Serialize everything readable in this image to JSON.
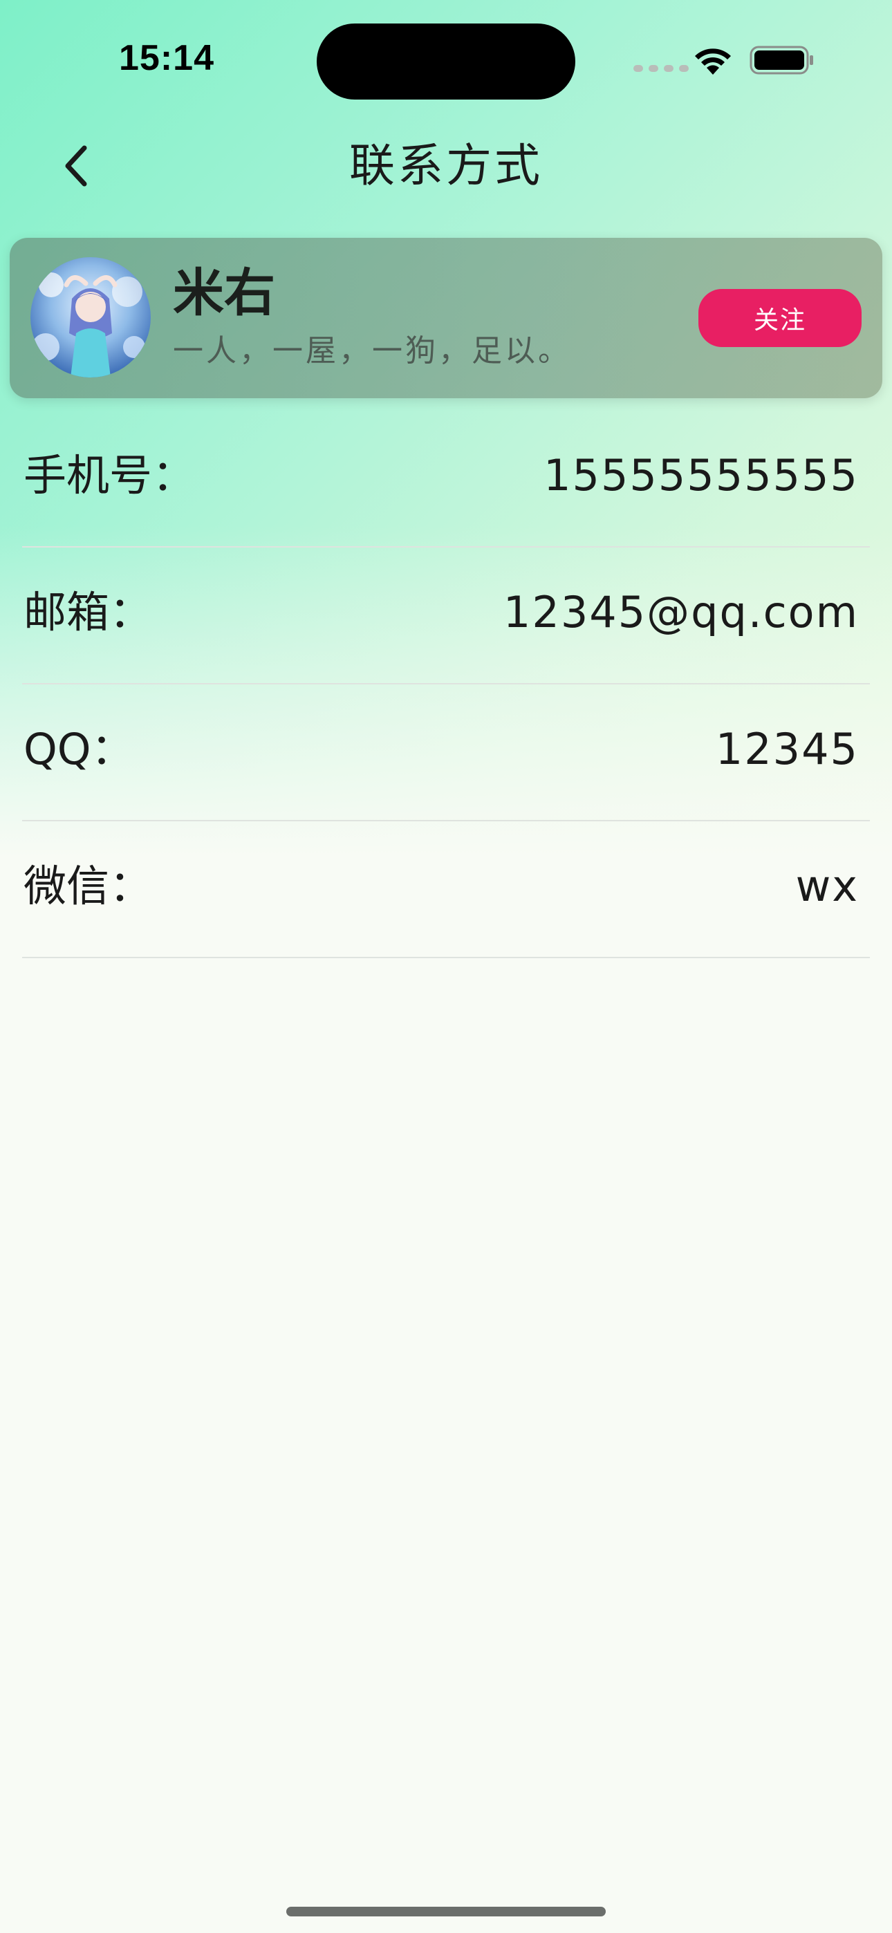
{
  "status_bar": {
    "time": "15:14"
  },
  "nav": {
    "title": "联系方式",
    "back_icon": "chevron-left-icon"
  },
  "profile": {
    "name": "米右",
    "bio": "一人，一屋，一狗，足以。",
    "follow_label": "关注",
    "follow_color": "#e81f63"
  },
  "contacts": [
    {
      "label": "手机号：",
      "value": "15555555555"
    },
    {
      "label": "邮箱：",
      "value": "12345@qq.com"
    },
    {
      "label": "QQ：",
      "value": "12345"
    },
    {
      "label": "微信：",
      "value": "wx"
    }
  ]
}
